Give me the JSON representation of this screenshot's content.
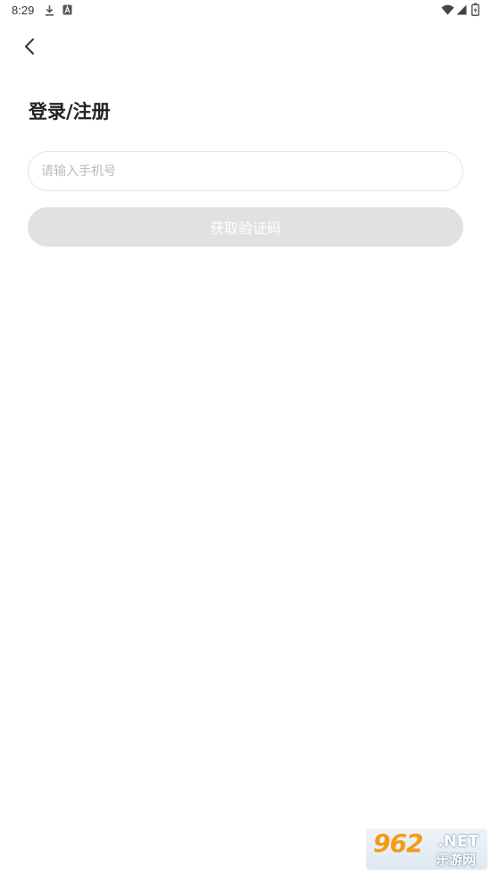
{
  "status_bar": {
    "time": "8:29",
    "left_icons": [
      "download-icon",
      "notification-a-icon"
    ],
    "right_icons": [
      "wifi-icon",
      "signal-icon",
      "battery-icon"
    ]
  },
  "nav": {
    "back_icon": "chevron-left-icon"
  },
  "login": {
    "title": "登录/注册",
    "phone_placeholder": "请输入手机号",
    "phone_value": "",
    "get_code_label": "获取验证码"
  },
  "colors": {
    "background": "#ffffff",
    "title": "#222222",
    "placeholder": "#bbbbbb",
    "input_border": "#e6e6e6",
    "button_disabled_bg": "#e1e1e1",
    "button_text": "#ffffff"
  },
  "watermark": {
    "number": "962",
    "suffix": ".NET",
    "site": "乐游网"
  }
}
